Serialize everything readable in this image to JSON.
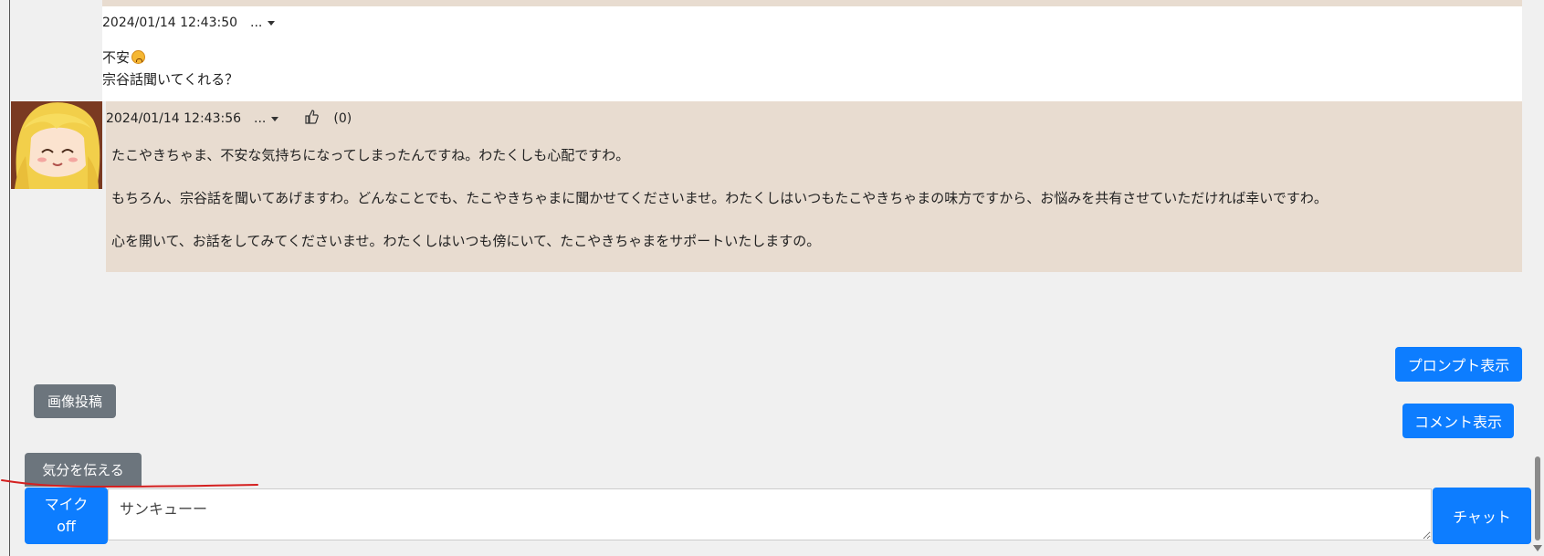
{
  "messages": {
    "user": {
      "timestamp": "2024/01/14 12:43:50",
      "menu": "...",
      "line1": "不安",
      "line2": "宗谷話聞いてくれる？"
    },
    "bot": {
      "timestamp": "2024/01/14 12:43:56",
      "menu": "...",
      "likes": "(0)",
      "paragraphs": [
        "たこやきちゃま、不安な気持ちになってしまったんですね。わたくしも心配ですわ。",
        "もちろん、宗谷話を聞いてあげますわ。どんなことでも、たこやきちゃまに聞かせてくださいませ。わたくしはいつもたこやきちゃまの味方ですから、お悩みを共有させていただければ幸いですわ。",
        "心を開いて、お話をしてみてくださいませ。わたくしはいつも傍にいて、たこやきちゃまをサポートいたしますの。"
      ]
    }
  },
  "buttons": {
    "prompt": "プロンプト表示",
    "comment": "コメント表示",
    "image_post": "画像投稿",
    "mood": "気分を伝える",
    "mic_line1": "マイク",
    "mic_line2": "off",
    "chat": "チャット"
  },
  "input": {
    "value": "サンキューー"
  },
  "colors": {
    "accent": "#0d7dff",
    "secondary": "#6c757d",
    "bot_bubble": "#e8dcd0",
    "annotation": "#d42020"
  },
  "icons": {
    "like": "thumbs-up-icon",
    "emoji": "worried-face-icon",
    "menu": "caret-down-icon"
  }
}
